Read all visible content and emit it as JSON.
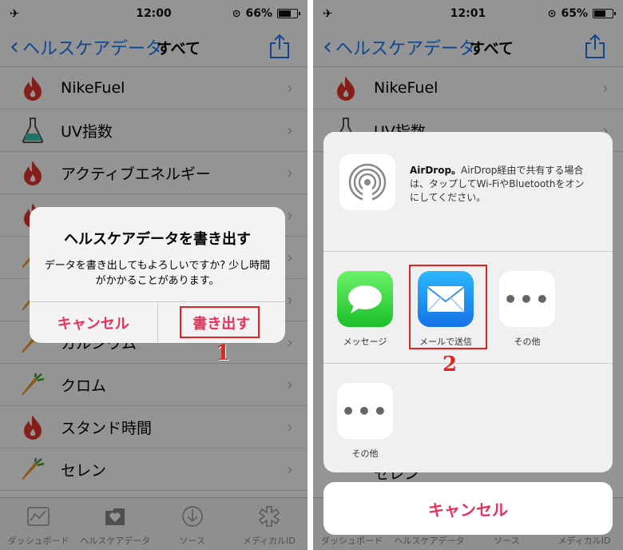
{
  "left": {
    "status": {
      "time": "12:00",
      "battery": "66%",
      "battery_level": 0.66
    },
    "nav": {
      "back_label": "ヘルスケアデータ",
      "title": "すべて"
    },
    "rows": [
      {
        "label": "NikeFuel",
        "icon": "flame-icon"
      },
      {
        "label": "UV指数",
        "icon": "flask-icon"
      },
      {
        "label": "アクティブエネルギー",
        "icon": "flame-icon"
      },
      {
        "label": "",
        "icon": "flame-icon"
      },
      {
        "label": "",
        "icon": "carrot-icon"
      },
      {
        "label": "",
        "icon": "carrot-icon"
      },
      {
        "label": "カルシウム",
        "icon": "carrot-icon"
      },
      {
        "label": "クロム",
        "icon": "carrot-icon"
      },
      {
        "label": "スタンド時間",
        "icon": "flame-icon"
      },
      {
        "label": "セレン",
        "icon": "carrot-icon"
      }
    ],
    "alert": {
      "title": "ヘルスケアデータを書き出す",
      "message": "データを書き出してもよろしいですか? 少し時間がかかることがあります。",
      "cancel": "キャンセル",
      "export": "書き出す"
    },
    "step": "1"
  },
  "right": {
    "status": {
      "time": "12:01",
      "battery": "65%",
      "battery_level": 0.65
    },
    "nav": {
      "back_label": "ヘルスケアデータ",
      "title": "すべて"
    },
    "rows": [
      {
        "label": "NikeFuel",
        "icon": "flame-icon"
      },
      {
        "label": "UV指数",
        "icon": "flask-icon"
      }
    ],
    "sheet": {
      "airdrop_title": "AirDrop。",
      "airdrop_text": "AirDrop経由で共有する場合は、タップしてWi-FiやBluetoothをオンにしてください。",
      "apps": [
        {
          "name": "メッセージ",
          "icon": "messages-icon"
        },
        {
          "name": "メールで送信",
          "icon": "mail-icon"
        },
        {
          "name": "その他",
          "icon": "more-icon"
        }
      ],
      "actions": [
        {
          "name": "その他",
          "icon": "more-icon"
        }
      ],
      "cancel": "キャンセル"
    },
    "bottom_partial_label": "セレン",
    "step": "2"
  },
  "tabs": [
    {
      "label": "ダッシュボード",
      "icon": "dashboard-icon"
    },
    {
      "label": "ヘルスケアデータ",
      "icon": "health-data-icon"
    },
    {
      "label": "ソース",
      "icon": "sources-icon"
    },
    {
      "label": "メディカルID",
      "icon": "medical-id-icon"
    }
  ],
  "colors": {
    "accent_blue": "#1a7cf5",
    "alert_red": "#e8325d",
    "annotation_red": "#e82020",
    "flame": "#e5342a",
    "carrot": "#f29a2e"
  }
}
